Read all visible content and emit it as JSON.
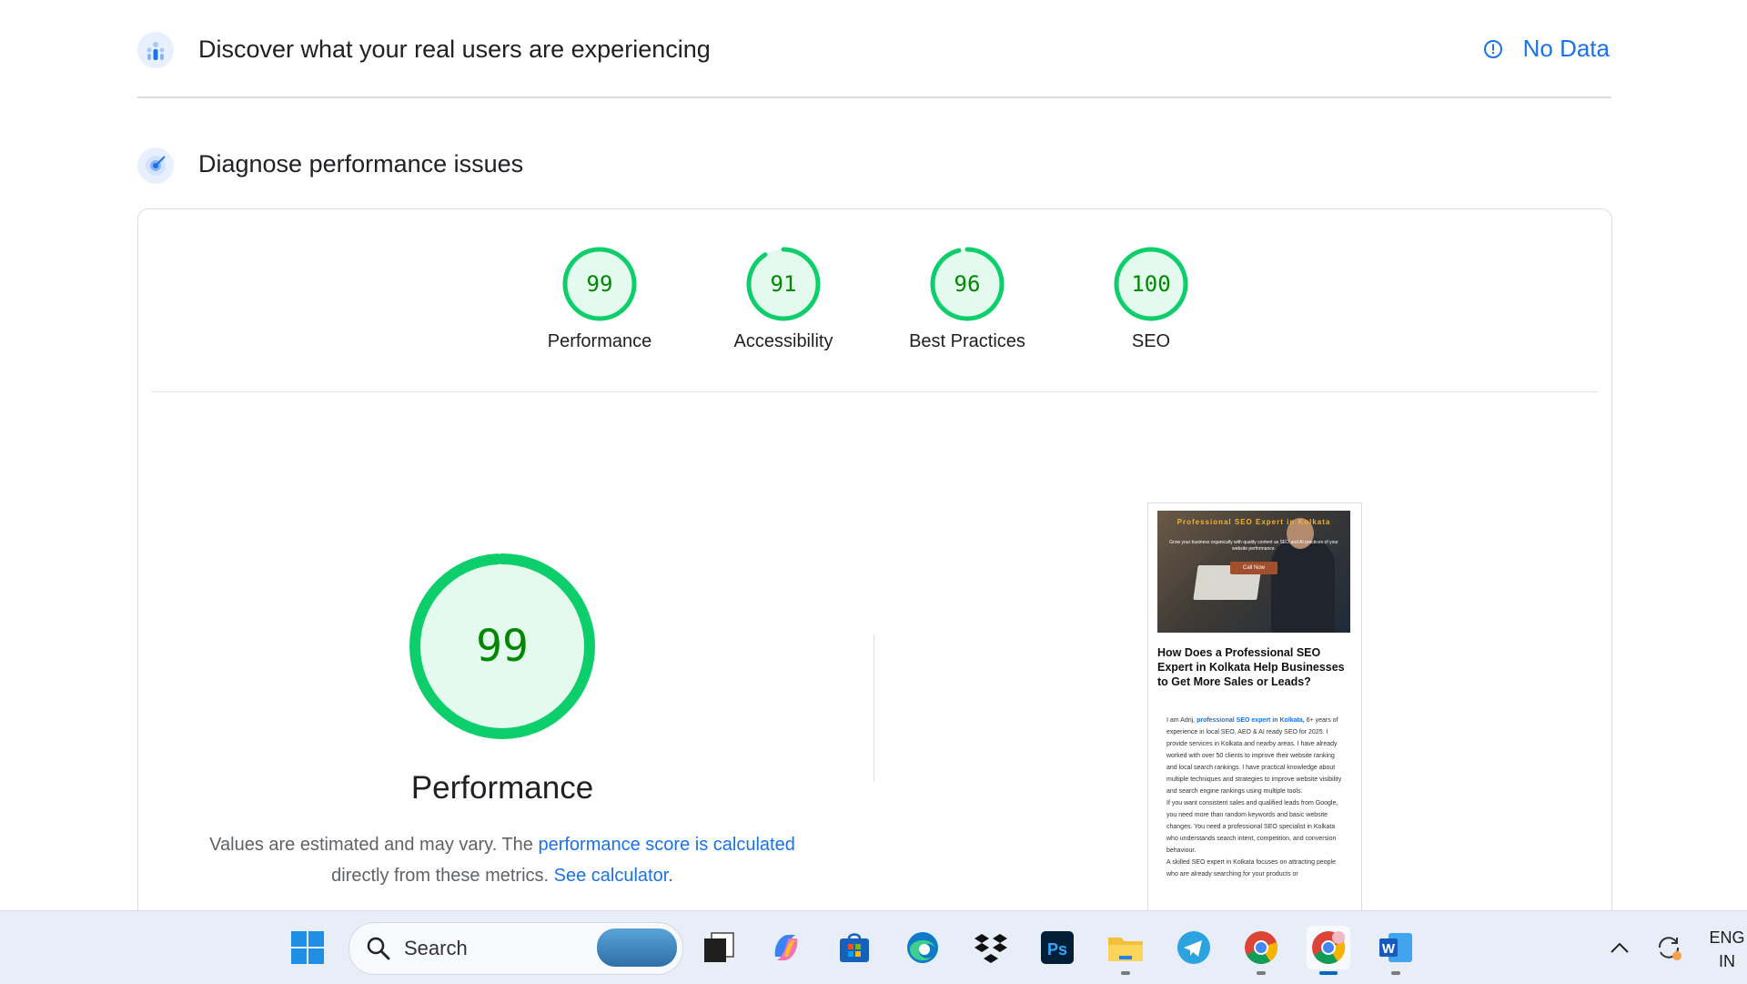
{
  "discover": {
    "title": "Discover what your real users are experiencing",
    "no_data": "No Data"
  },
  "diagnose": {
    "title": "Diagnose performance issues"
  },
  "colors": {
    "pass": "#0cce6b",
    "pass_text": "#008800",
    "pass_fill": "#e5faef",
    "link": "#1a73e8"
  },
  "scores": [
    {
      "label": "Performance",
      "value": 99
    },
    {
      "label": "Accessibility",
      "value": 91
    },
    {
      "label": "Best Practices",
      "value": 96
    },
    {
      "label": "SEO",
      "value": 100
    }
  ],
  "main_metric": {
    "value": "99",
    "label": "Performance",
    "note_1": "Values are estimated and may vary. The",
    "note_link_1": "performance score is calculated",
    "note_2": "directly from these metrics.",
    "note_link_2": "See calculator."
  },
  "thumbnail": {
    "hero_title": "Professional SEO Expert in Kolkata",
    "hero_sub": "Grow your business organically with quality content as SEO and AI practices of your website performance.",
    "cta": "Call Now",
    "heading": "How Does a Professional SEO Expert in Kolkata Help Businesses to Get More Sales or Leads?",
    "p1_a": "I am Adrij,",
    "p1_link": "professional SEO expert in Kolkata,",
    "p1_b": "6+ years of experience in local SEO, AEO & AI ready SEO for 2025. I provide services in Kolkata and nearby areas. I have already worked with over 50 clients to improve their website ranking and local search rankings. I have practical knowledge about multiple techniques and strategies to improve website visibility and search engine rankings using multiple tools.",
    "p2": "If you want consistent sales and qualified leads from Google, you need more than random keywords and basic website changes. You need a professional SEO specialist in Kolkata who understands search intent, competition, and conversion behaviour.",
    "p3": "A skilled SEO expert in Kolkata focuses on attracting people who are already searching for your products or"
  },
  "taskbar": {
    "search_placeholder": "Search",
    "apps": [
      "start-icon",
      "task-view-icon",
      "copilot-icon",
      "store-icon",
      "edge-icon",
      "dropbox-icon",
      "photoshop-icon",
      "file-explorer-icon",
      "telegram-icon",
      "chrome-icon",
      "chrome-profile-icon",
      "word-icon"
    ],
    "photoshop_label": "Ps",
    "word_label": "W",
    "lang_1": "ENG",
    "lang_2": "IN"
  }
}
